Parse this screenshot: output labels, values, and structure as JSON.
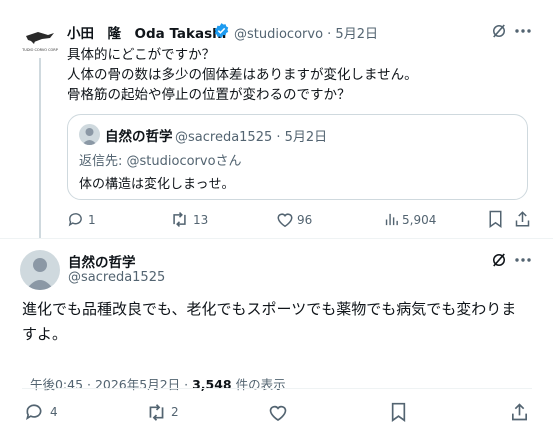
{
  "reply_tweet": {
    "display_name": "小田　隆　Oda Takashi",
    "handle_date": "@studiocorvo · 5月2日",
    "avatar_text": "TUDIO CORVO CORP",
    "lines": [
      "具体的にどこがですか？",
      "人体の骨の数は多少の個体差はありますが変化しません。",
      "骨格筋の起始や停止の位置が変わるのですか？"
    ],
    "quoted": {
      "display_name": "自然の哲学",
      "handle_date": "@sacreda1525 · 5月2日",
      "reply_to": "返信先: @studiocorvoさん",
      "text": "体の構造は変化しまっせ。"
    },
    "actions": {
      "replies": "1",
      "reposts": "13",
      "likes": "96",
      "views": "5,904"
    }
  },
  "main_tweet": {
    "display_name": "自然の哲学",
    "handle": "@sacreda1525",
    "text_lines": [
      "進化でも品種改良でも、老化でもスポーツでも薬物でも病気でも変わりま",
      "すよ。"
    ],
    "time": "午後0:45 · 2026年5月2日 · ",
    "view_count": "3,548",
    "view_label": " 件の表示",
    "actions": {
      "replies": "4",
      "reposts": "2"
    }
  },
  "colors": {
    "verified": "#1d9bf0",
    "muted": "#536471",
    "border": "#cfd9de"
  }
}
